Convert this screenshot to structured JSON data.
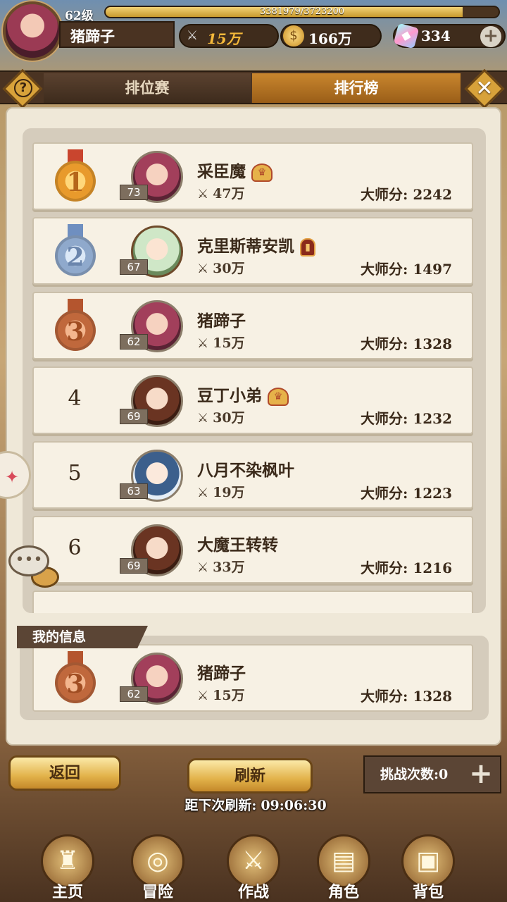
{
  "player": {
    "level": "62级",
    "xp": "3381979/3723200",
    "xp_fraction": 0.908,
    "name": "猪蹄子",
    "power": "15万",
    "gold": "166万",
    "gems": "334"
  },
  "tabs": {
    "rank_match": "排位赛",
    "leaderboard": "排行榜"
  },
  "leaderboard": [
    {
      "rank": "1",
      "level": "73",
      "name": "采臣魔",
      "power": "47万",
      "score": "大师分: 2242",
      "medal": "gold",
      "badge": "crown",
      "avatar": "pink"
    },
    {
      "rank": "2",
      "level": "67",
      "name": "克里斯蒂安凯",
      "power": "30万",
      "score": "大师分: 1497",
      "medal": "silver",
      "badge": "helm",
      "avatar": "green"
    },
    {
      "rank": "3",
      "level": "62",
      "name": "猪蹄子",
      "power": "15万",
      "score": "大师分: 1328",
      "medal": "bronze",
      "badge": "",
      "avatar": "pink"
    },
    {
      "rank": "4",
      "level": "69",
      "name": "豆丁小弟",
      "power": "30万",
      "score": "大师分: 1232",
      "medal": "",
      "badge": "crown",
      "avatar": "brown"
    },
    {
      "rank": "5",
      "level": "63",
      "name": "八月不染枫叶",
      "power": "19万",
      "score": "大师分: 1223",
      "medal": "",
      "badge": "",
      "avatar": "blue"
    },
    {
      "rank": "6",
      "level": "69",
      "name": "大魔王转转",
      "power": "33万",
      "score": "大师分: 1216",
      "medal": "",
      "badge": "",
      "avatar": "brown"
    }
  ],
  "my_info": {
    "header": "我的信息",
    "rank": "3",
    "level": "62",
    "name": "猪蹄子",
    "power": "15万",
    "score": "大师分: 1328"
  },
  "buttons": {
    "back": "返回",
    "refresh": "刷新"
  },
  "challenge": "挑战次数:0",
  "refresh_timer": {
    "label": "距下次刷新:",
    "time": "09:06:30"
  },
  "nav": [
    "主页",
    "冒险",
    "作战",
    "角色",
    "背包"
  ]
}
